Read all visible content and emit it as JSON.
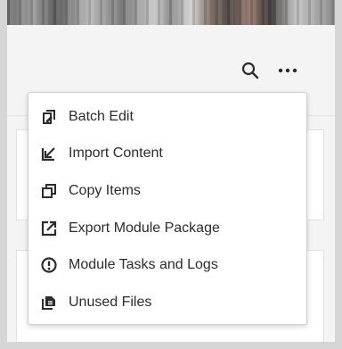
{
  "toolbar": {
    "search_icon": "search-icon",
    "more_icon": "more-horizontal-icon"
  },
  "menu": {
    "items": [
      {
        "label": "Batch Edit",
        "icon": "batch-edit-icon"
      },
      {
        "label": "Import Content",
        "icon": "import-arrow-icon"
      },
      {
        "label": "Copy Items",
        "icon": "copy-icon"
      },
      {
        "label": "Export Module Package",
        "icon": "export-external-icon"
      },
      {
        "label": "Module Tasks and Logs",
        "icon": "alert-circle-icon"
      },
      {
        "label": "Unused Files",
        "icon": "unused-files-icon"
      }
    ]
  },
  "colors": {
    "text": "#2c2c2c",
    "icon": "#2c2c2c",
    "menu_background": "#ffffff",
    "page_background": "#f4f4f4"
  }
}
